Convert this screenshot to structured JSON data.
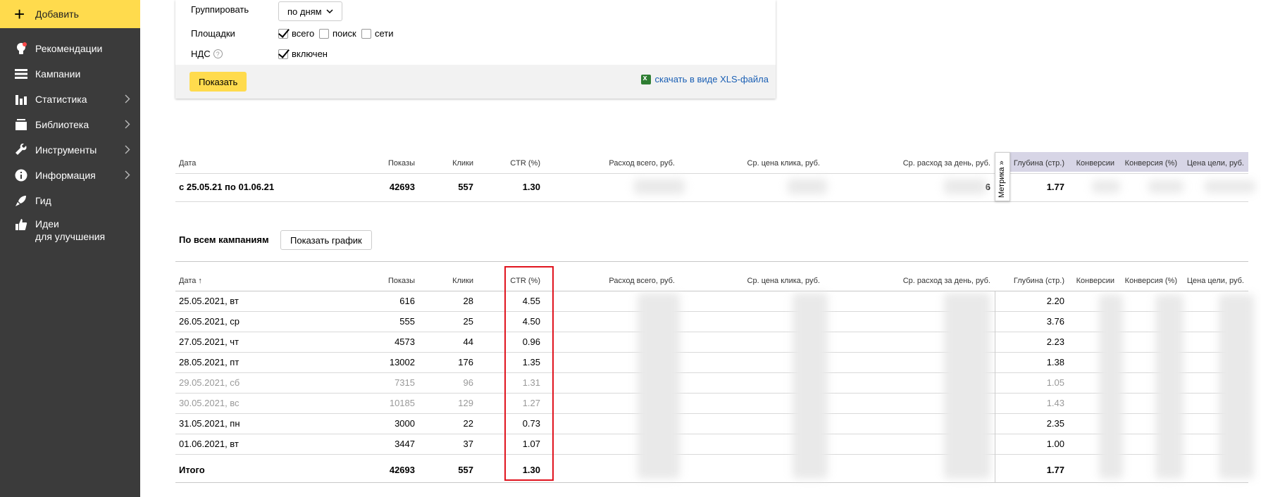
{
  "sidebar": {
    "add_label": "Добавить",
    "items": [
      {
        "label": "Рекомендации",
        "icon": "bulb-icon",
        "chevron": false
      },
      {
        "label": "Кампании",
        "icon": "list-icon",
        "chevron": false
      },
      {
        "label": "Статистика",
        "icon": "bar-chart-icon",
        "chevron": true
      },
      {
        "label": "Библиотека",
        "icon": "library-icon",
        "chevron": true
      },
      {
        "label": "Инструменты",
        "icon": "wrench-icon",
        "chevron": true
      },
      {
        "label": "Информация",
        "icon": "info-icon",
        "chevron": true
      },
      {
        "label": "Гид",
        "icon": "rocket-icon",
        "chevron": false
      },
      {
        "label": "Идеи\nдля улучшения",
        "icon": "thumbs-up-icon",
        "chevron": false
      }
    ]
  },
  "filter": {
    "group_label": "Группировать",
    "group_value": "по дням",
    "sites_label": "Площадки",
    "sites": [
      {
        "label": "всего",
        "checked": true
      },
      {
        "label": "поиск",
        "checked": false
      },
      {
        "label": "сети",
        "checked": false
      }
    ],
    "vat_label": "НДС",
    "vat_option": {
      "label": "включен",
      "checked": true
    },
    "show_button": "Показать",
    "xls_link": "скачать в виде XLS-файла"
  },
  "summary": {
    "headers": [
      "Дата",
      "Показы",
      "Клики",
      "CTR (%)",
      "Расход всего, руб.",
      "Ср. цена клика, руб.",
      "Ср. расход за день, руб.",
      "Глубина (стр.)",
      "Конверсии",
      "Конверсия (%)",
      "Цена цели, руб."
    ],
    "row": {
      "date": "с 25.05.21 по 01.06.21",
      "shows": "42693",
      "clicks": "557",
      "ctr": "1.30",
      "daily_tail": "6",
      "depth": "1.77"
    },
    "metrika_label": "Метрика »"
  },
  "campaigns": {
    "title": "По всем кампаниям",
    "graph_button": "Показать график",
    "headers": [
      "Дата ↑",
      "Показы",
      "Клики",
      "CTR (%)",
      "Расход всего, руб.",
      "Ср. цена клика, руб.",
      "Ср. расход за день, руб.",
      "Глубина (стр.)",
      "Конверсии",
      "Конверсия (%)",
      "Цена цели, руб."
    ],
    "rows": [
      {
        "date": "25.05.2021, вт",
        "shows": "616",
        "clicks": "28",
        "ctr": "4.55",
        "depth": "2.20",
        "weekend": false
      },
      {
        "date": "26.05.2021, ср",
        "shows": "555",
        "clicks": "25",
        "ctr": "4.50",
        "depth": "3.76",
        "weekend": false
      },
      {
        "date": "27.05.2021, чт",
        "shows": "4573",
        "clicks": "44",
        "ctr": "0.96",
        "depth": "2.23",
        "weekend": false
      },
      {
        "date": "28.05.2021, пт",
        "shows": "13002",
        "clicks": "176",
        "ctr": "1.35",
        "depth": "1.38",
        "weekend": false
      },
      {
        "date": "29.05.2021, сб",
        "shows": "7315",
        "clicks": "96",
        "ctr": "1.31",
        "depth": "1.05",
        "weekend": true
      },
      {
        "date": "30.05.2021, вс",
        "shows": "10185",
        "clicks": "129",
        "ctr": "1.27",
        "depth": "1.43",
        "weekend": true
      },
      {
        "date": "31.05.2021, пн",
        "shows": "3000",
        "clicks": "22",
        "ctr": "0.73",
        "depth": "2.35",
        "weekend": false
      },
      {
        "date": "01.06.2021, вт",
        "shows": "3447",
        "clicks": "37",
        "ctr": "1.07",
        "depth": "1.00",
        "weekend": false
      }
    ],
    "total": {
      "label": "Итого",
      "shows": "42693",
      "clicks": "557",
      "ctr": "1.30",
      "depth": "1.77"
    }
  },
  "colors": {
    "accent": "#ffdb4d",
    "sidebar_bg": "#3b3b3b",
    "highlight": "#e0141e",
    "metrika_bg": "#d7d5e6"
  }
}
